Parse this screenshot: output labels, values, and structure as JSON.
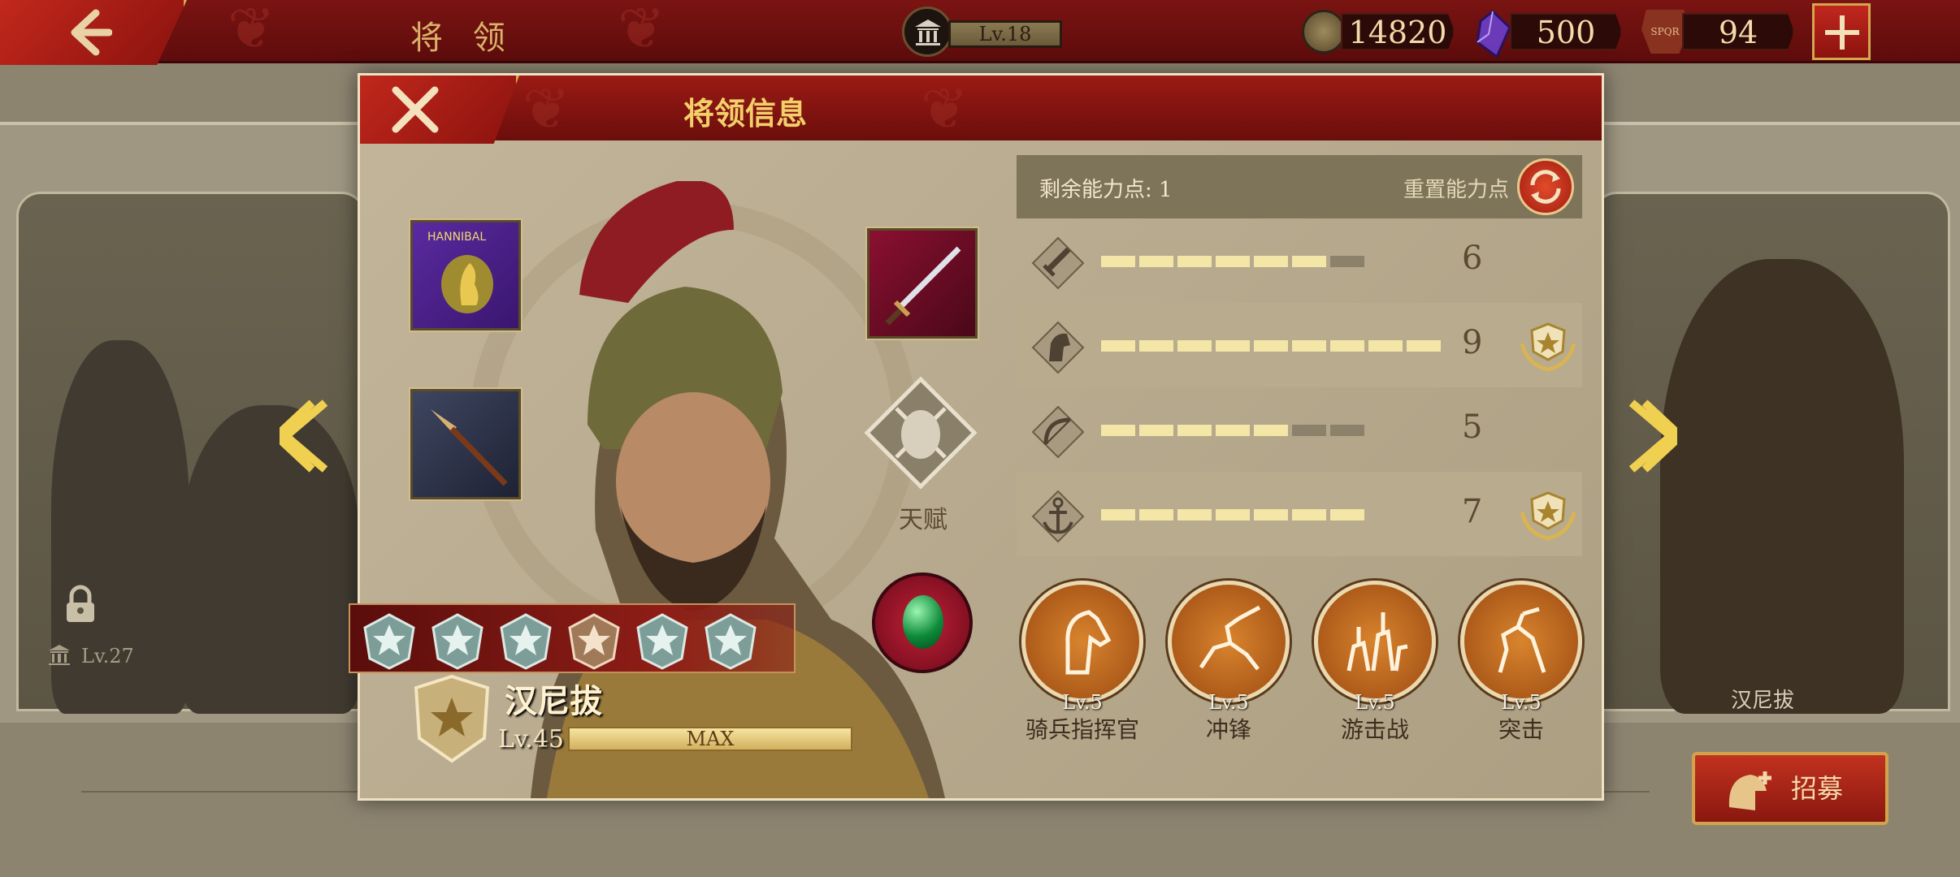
{
  "topbar": {
    "title": "将 领",
    "castle_level": "Lv.18",
    "resources": {
      "coins": "14820",
      "gems": "500",
      "spqr": "94"
    },
    "spqr_icon_text": "SPQR"
  },
  "background": {
    "left_card_level": "Lv.27",
    "right_card_name": "汉尼拔",
    "recruit_label": "招募"
  },
  "modal": {
    "title": "将领信息",
    "items": [
      {
        "name": "hannibal-banner",
        "text": "HANNIBAL"
      },
      {
        "name": "spear"
      },
      {
        "name": "sword"
      }
    ],
    "talent_label": "天赋",
    "general": {
      "name": "汉尼拔",
      "level": "Lv.45",
      "xp_label": "MAX",
      "rank_stars": 6
    },
    "points": {
      "remaining_label": "剩余能力点:",
      "remaining_value": "1",
      "reset_label": "重置能力点"
    },
    "stats": [
      {
        "icon": "sword-icon",
        "value": "6",
        "filled": 6,
        "total": 7,
        "medal": false
      },
      {
        "icon": "horse-icon",
        "value": "9",
        "filled": 9,
        "total": 9,
        "medal": true
      },
      {
        "icon": "bow-icon",
        "value": "5",
        "filled": 5,
        "total": 7,
        "medal": false
      },
      {
        "icon": "anchor-icon",
        "value": "7",
        "filled": 7,
        "total": 7,
        "medal": true
      }
    ],
    "skills": [
      {
        "level": "Lv.5",
        "name": "骑兵指挥官"
      },
      {
        "level": "Lv.5",
        "name": "冲锋"
      },
      {
        "level": "Lv.5",
        "name": "游击战"
      },
      {
        "level": "Lv.5",
        "name": "突击"
      }
    ]
  },
  "colors": {
    "accent_red": "#8b130f",
    "gold": "#f3cf6a",
    "parchment": "#b9ab8f"
  }
}
